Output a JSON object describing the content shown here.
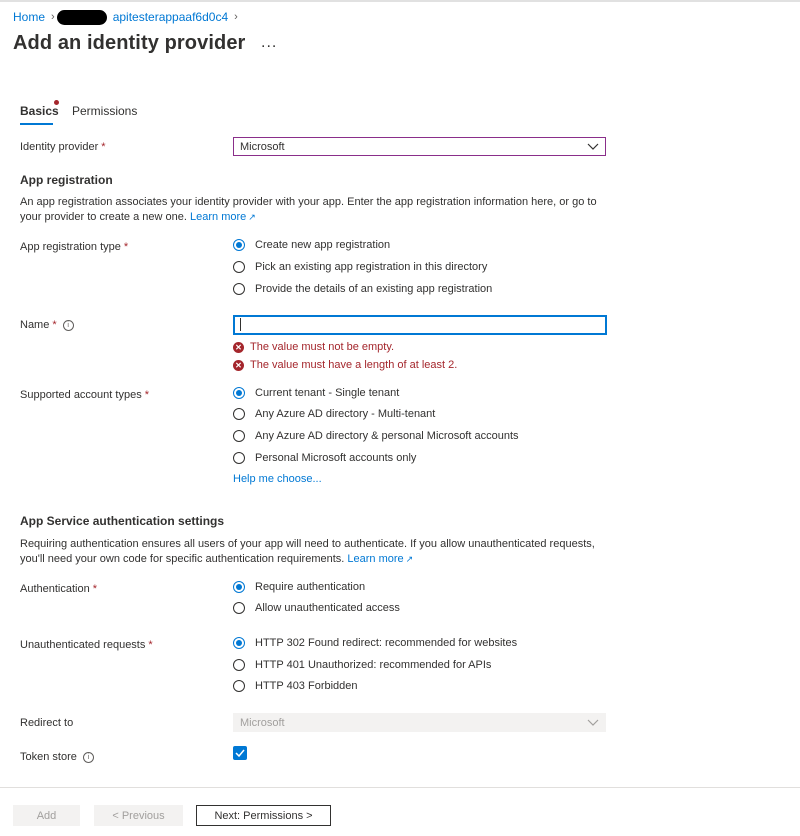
{
  "breadcrumb": {
    "home": "Home",
    "resource": "apitesterappaaf6d0c4"
  },
  "header": {
    "title": "Add an identity provider",
    "more": "..."
  },
  "tabs": [
    {
      "label": "Basics",
      "selected": true
    },
    {
      "label": "Permissions",
      "selected": false
    }
  ],
  "identity_provider": {
    "label": "Identity provider",
    "required": "*",
    "value": "Microsoft"
  },
  "app_registration": {
    "heading": "App registration",
    "description": "An app registration associates your identity provider with your app. Enter the app registration information here, or go to your provider to create a new one.",
    "learn_more": "Learn more",
    "type_label": "App registration type",
    "required": "*",
    "options": [
      {
        "label": "Create new app registration",
        "selected": true
      },
      {
        "label": "Pick an existing app registration in this directory",
        "selected": false
      },
      {
        "label": "Provide the details of an existing app registration",
        "selected": false
      }
    ]
  },
  "name_field": {
    "label": "Name",
    "required": "*",
    "value": "",
    "errors": [
      "The value must not be empty.",
      "The value must have a length of at least 2."
    ]
  },
  "account_types": {
    "label": "Supported account types",
    "required": "*",
    "options": [
      {
        "label": "Current tenant - Single tenant",
        "selected": true
      },
      {
        "label": "Any Azure AD directory - Multi-tenant",
        "selected": false
      },
      {
        "label": "Any Azure AD directory & personal Microsoft accounts",
        "selected": false
      },
      {
        "label": "Personal Microsoft accounts only",
        "selected": false
      }
    ],
    "help_link": "Help me choose..."
  },
  "auth_settings": {
    "heading": "App Service authentication settings",
    "description": "Requiring authentication ensures all users of your app will need to authenticate. If you allow unauthenticated requests, you'll need your own code for specific authentication requirements.",
    "learn_more": "Learn more",
    "authentication": {
      "label": "Authentication",
      "required": "*",
      "options": [
        {
          "label": "Require authentication",
          "selected": true
        },
        {
          "label": "Allow unauthenticated access",
          "selected": false
        }
      ]
    },
    "unauthenticated_requests": {
      "label": "Unauthenticated requests",
      "required": "*",
      "options": [
        {
          "label": "HTTP 302 Found redirect: recommended for websites",
          "selected": true
        },
        {
          "label": "HTTP 401 Unauthorized: recommended for APIs",
          "selected": false
        },
        {
          "label": "HTTP 403 Forbidden",
          "selected": false
        }
      ]
    },
    "redirect_to": {
      "label": "Redirect to",
      "value": "Microsoft"
    },
    "token_store": {
      "label": "Token store",
      "checked": true
    }
  },
  "footer": {
    "add": "Add",
    "previous": "< Previous",
    "next": "Next: Permissions >"
  },
  "colors": {
    "accent": "#0078d4",
    "error": "#a4262c",
    "required": "#a4262c",
    "focus_border_dropdown": "#8a2e8a"
  },
  "icons": {
    "breadcrumb_separator": "chevron-right-icon",
    "more": "ellipsis-icon",
    "dropdown": "chevron-down-icon",
    "info": "info-icon",
    "error": "error-circle-icon",
    "external_link": "external-link-icon",
    "checkbox": "checkmark-icon"
  }
}
